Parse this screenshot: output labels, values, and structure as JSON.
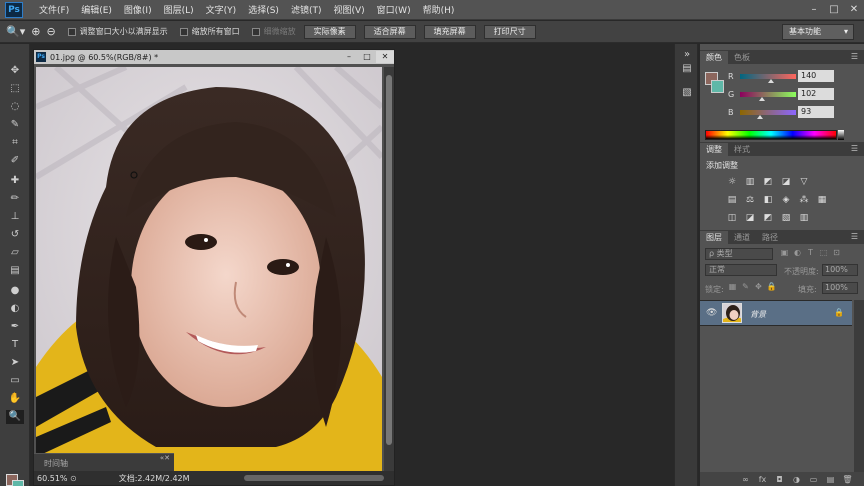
{
  "app": {
    "logo": "Ps"
  },
  "menu": [
    "文件(F)",
    "编辑(E)",
    "图像(I)",
    "图层(L)",
    "文字(Y)",
    "选择(S)",
    "滤镜(T)",
    "视图(V)",
    "窗口(W)",
    "帮助(H)"
  ],
  "window_buttons": [
    "–",
    "□",
    "✕"
  ],
  "options": {
    "resize_label": "调整窗口大小以满屏显示",
    "zoom_all_label": "缩放所有窗口",
    "scrubby_label": "细微缩放",
    "buttons": [
      "实际像素",
      "适合屏幕",
      "填充屏幕",
      "打印尺寸"
    ],
    "workspace": "基本功能"
  },
  "document": {
    "title": "01.jpg @ 60.5%(RGB/8#) *",
    "ps_icon": "Ps",
    "buttons": [
      "–",
      "□",
      "✕"
    ],
    "zoom": "60.51%",
    "info": "文档:2.42M/2.42M",
    "timeline": "时间轴",
    "timeline_close": "«✕"
  },
  "panels": {
    "color_tabs": [
      "颜色",
      "色板"
    ],
    "rgb": [
      {
        "label": "R",
        "value": "140",
        "position": 0.55,
        "gradient": "linear-gradient(to right,#006680,#ff665d)"
      },
      {
        "label": "G",
        "value": "102",
        "position": 0.4,
        "gradient": "linear-gradient(to right,#8c005d,#8cff5d)"
      },
      {
        "label": "B",
        "value": "93",
        "position": 0.36,
        "gradient": "linear-gradient(to right,#8c6600,#8c66ff)"
      }
    ],
    "adj_tabs": [
      "调整",
      "样式"
    ],
    "adj_title": "添加调整",
    "adj_row1": [
      "☼",
      "▥",
      "◩",
      "◪",
      "▽"
    ],
    "adj_row2": [
      "▤",
      "⚖",
      "◧",
      "◈",
      "⁂",
      "▦"
    ],
    "adj_row3": [
      "◫",
      "◪",
      "◩",
      "▧",
      "▥"
    ],
    "layers_tabs": [
      "图层",
      "通道",
      "路径"
    ],
    "filter": "ρ 类型",
    "filter_icons": [
      "▣",
      "◐",
      "T",
      "⬚",
      "⊡"
    ],
    "blend": "正常",
    "opacity_label": "不透明度:",
    "opacity": "100%",
    "lock_label": "锁定:",
    "lock_icons": [
      "▦",
      "✎",
      "✥",
      "🔒"
    ],
    "fill_label": "填充:",
    "fill": "100%",
    "layer_name": "背景",
    "footer_icons": [
      "∞",
      "fx",
      "◘",
      "◑",
      "▭",
      "▤",
      "🗑"
    ]
  },
  "colors": {
    "foreground": "#8c665d",
    "background": "#5fb8a8"
  }
}
